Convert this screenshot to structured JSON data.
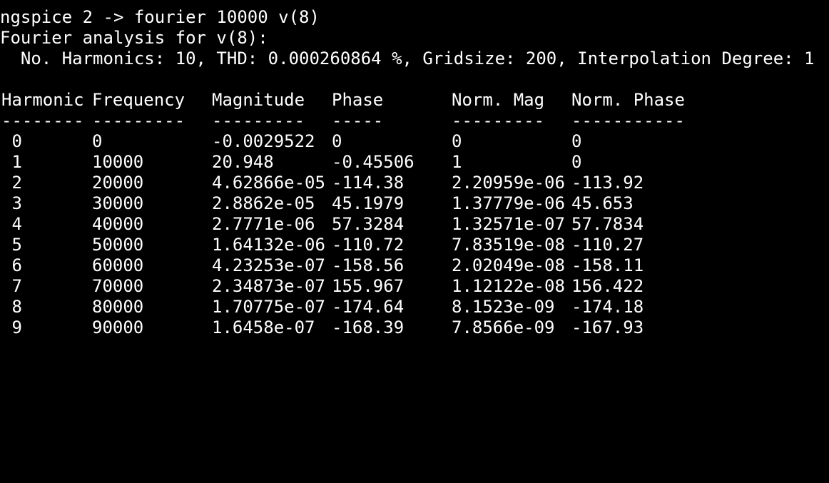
{
  "terminal": {
    "prompt_line": "ngspice 2 -> fourier 10000 v(8)",
    "analysis_title": "Fourier analysis for v(8):",
    "summary_line": "  No. Harmonics: 10, THD: 0.000260864 %, Gridsize: 200, Interpolation Degree: 1",
    "headers": [
      "Harmonic",
      "Frequency",
      "Magnitude",
      "Phase",
      "Norm. Mag",
      "Norm. Phase"
    ],
    "separators": [
      "--------",
      "---------",
      "---------",
      "-----",
      "---------",
      "-----------"
    ],
    "rows": [
      [
        " 0",
        "0",
        "-0.0029522",
        "0",
        "0",
        "0"
      ],
      [
        " 1",
        "10000",
        "20.948",
        "-0.45506",
        "1",
        "0"
      ],
      [
        " 2",
        "20000",
        "4.62866e-05",
        "-114.38",
        "2.20959e-06",
        "-113.92"
      ],
      [
        " 3",
        "30000",
        "2.8862e-05",
        "45.1979",
        "1.37779e-06",
        "45.653"
      ],
      [
        " 4",
        "40000",
        "2.7771e-06",
        "57.3284",
        "1.32571e-07",
        "57.7834"
      ],
      [
        " 5",
        "50000",
        "1.64132e-06",
        "-110.72",
        "7.83519e-08",
        "-110.27"
      ],
      [
        " 6",
        "60000",
        "4.23253e-07",
        "-158.56",
        "2.02049e-08",
        "-158.11"
      ],
      [
        " 7",
        "70000",
        "2.34873e-07",
        "155.967",
        "1.12122e-08",
        "156.422"
      ],
      [
        " 8",
        "80000",
        "1.70775e-07",
        "-174.64",
        "8.1523e-09",
        "-174.18"
      ],
      [
        " 9",
        "90000",
        "1.6458e-07",
        "-168.39",
        "7.8566e-09",
        "-167.93"
      ]
    ]
  }
}
